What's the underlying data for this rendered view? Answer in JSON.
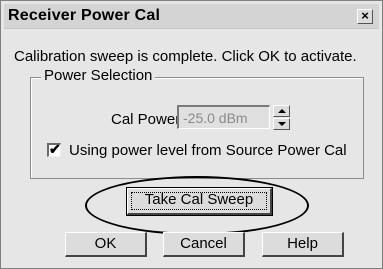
{
  "dialog": {
    "title": "Receiver Power Cal",
    "close_glyph": "×",
    "message": "Calibration sweep is complete.  Click OK to activate."
  },
  "power_selection": {
    "legend": "Power Selection",
    "cal_power_label": "Cal Power",
    "cal_power_value": "-25.0 dBm",
    "checkbox_checked": true,
    "checkbox_mark": "✔",
    "checkbox_label": "Using power level from Source Power Cal"
  },
  "buttons": {
    "take_cal_sweep": "Take Cal Sweep",
    "ok": "OK",
    "cancel": "Cancel",
    "help": "Help"
  },
  "icons": {
    "close": "close-icon",
    "spin_up": "triangle-up-icon",
    "spin_down": "triangle-down-icon",
    "check": "checkmark-icon"
  }
}
